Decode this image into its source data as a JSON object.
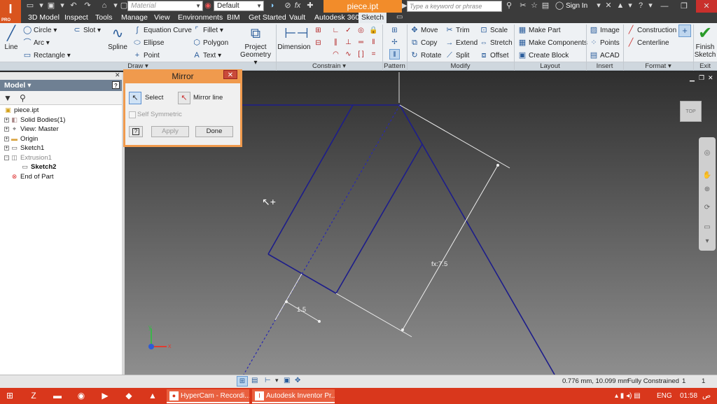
{
  "titlebar": {
    "app_logo": "I",
    "app_logo_sub": "PRO",
    "material_placeholder": "Material",
    "appearance_value": "Default",
    "fx_label": "fx",
    "document_title": "piece.ipt",
    "search_placeholder": "Type a keyword or phrase",
    "sign_in": "Sign In"
  },
  "menu": {
    "tabs": [
      "3D Model",
      "Inspect",
      "Tools",
      "Manage",
      "View",
      "Environments",
      "BIM",
      "Get Started",
      "Vault",
      "Autodesk 360",
      "Sketch"
    ],
    "active_tab": "Sketch"
  },
  "ribbon": {
    "draw": {
      "line": "Line",
      "circle": "Circle",
      "arc": "Arc",
      "rectangle": "Rectangle",
      "slot": "Slot",
      "spline": "Spline",
      "equation_curve": "Equation Curve",
      "ellipse": "Ellipse",
      "point": "Point",
      "fillet": "Fillet",
      "polygon": "Polygon",
      "text": "Text",
      "project_geometry_1": "Project",
      "project_geometry_2": "Geometry"
    },
    "constrain": {
      "dimension": "Dimension"
    },
    "modify": {
      "move": "Move",
      "copy": "Copy",
      "rotate": "Rotate",
      "trim": "Trim",
      "extend": "Extend",
      "split": "Split",
      "scale": "Scale",
      "stretch": "Stretch",
      "offset": "Offset"
    },
    "layout": {
      "make_part": "Make Part",
      "make_components": "Make Components",
      "create_block": "Create Block"
    },
    "insert": {
      "image": "Image",
      "points": "Points",
      "acad": "ACAD"
    },
    "format": {
      "construction": "Construction",
      "centerline": "Centerline"
    },
    "exit": {
      "finish_1": "Finish",
      "finish_2": "Sketch"
    },
    "groups": {
      "draw": "Draw",
      "constrain": "Constrain",
      "pattern": "Pattern",
      "modify": "Modify",
      "layout": "Layout",
      "insert": "Insert",
      "format": "Format",
      "exit": "Exit"
    }
  },
  "browser": {
    "title": "Model",
    "help": "?",
    "tree": [
      {
        "label": "piece.ipt",
        "icon": "part-icon",
        "bold": false
      },
      {
        "label": "Solid Bodies(1)",
        "icon": "solid-bodies-icon",
        "bold": false
      },
      {
        "label": "View: Master",
        "icon": "view-icon",
        "bold": false
      },
      {
        "label": "Origin",
        "icon": "folder-icon",
        "bold": false
      },
      {
        "label": "Sketch1",
        "icon": "sketch-icon",
        "bold": false
      },
      {
        "label": "Extrusion1",
        "icon": "extrusion-icon",
        "bold": false
      },
      {
        "label": "Sketch2",
        "icon": "sketch-icon",
        "bold": true
      },
      {
        "label": "End of Part",
        "icon": "end-of-part-icon",
        "bold": false
      }
    ]
  },
  "mirror_dialog": {
    "title": "Mirror",
    "select": "Select",
    "mirror_line": "Mirror line",
    "self_symmetric": "Self Symmetric",
    "help": "?",
    "apply": "Apply",
    "done": "Done"
  },
  "canvas": {
    "viewcube_label": "TOP",
    "dim_1": "1.5",
    "dim_2": "fx:7.5",
    "axis_x": "x",
    "axis_y": "y"
  },
  "status": {
    "coords": "0.776 mm, 10.099 mm",
    "constraint_state": "Fully Constrained",
    "count_1": "1",
    "count_2": "1"
  },
  "taskbar": {
    "task_1": "HyperCam - Recordi...",
    "task_2": "Autodesk Inventor Pr...",
    "language": "ENG",
    "time": "01:58",
    "ampm": "ص"
  },
  "colors": {
    "accent": "#f28c2a",
    "taskbar": "#d9371c",
    "sketch_line": "#1a1a8c",
    "dialog_border": "#f09a4d"
  }
}
